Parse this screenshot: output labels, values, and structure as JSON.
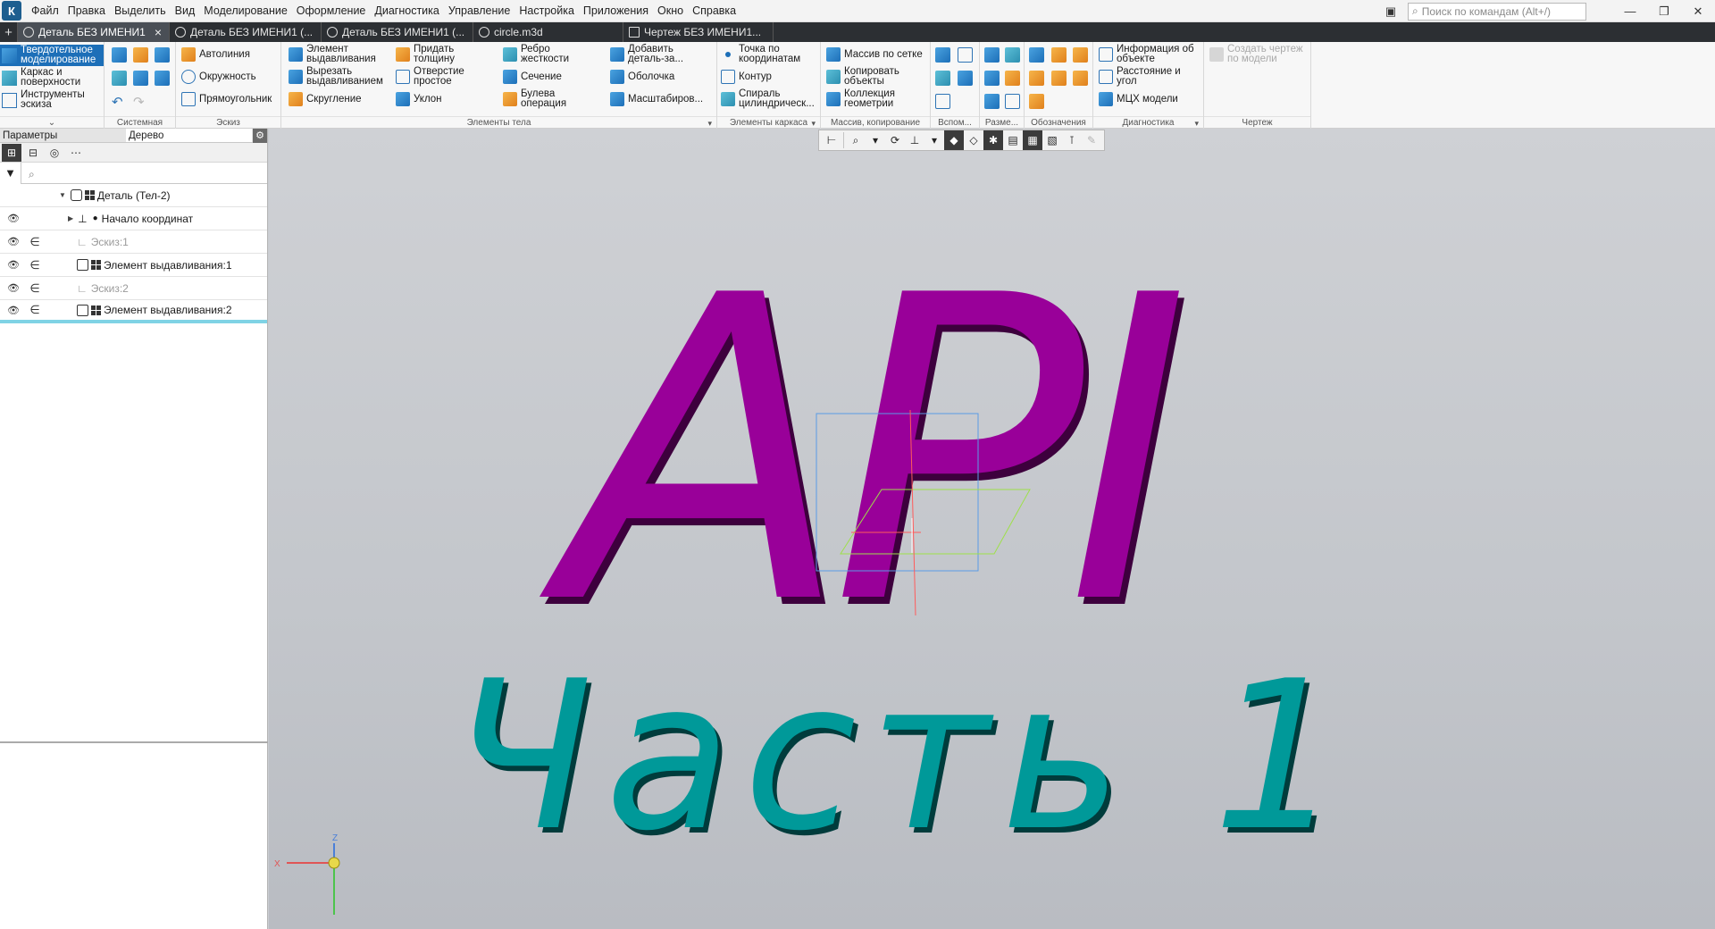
{
  "menu": [
    "Файл",
    "Правка",
    "Выделить",
    "Вид",
    "Моделирование",
    "Оформление",
    "Диагностика",
    "Управление",
    "Настройка",
    "Приложения",
    "Окно",
    "Справка"
  ],
  "search": {
    "placeholder": "Поиск по командам (Alt+/)"
  },
  "tabs": [
    {
      "label": "Деталь БЕЗ ИМЕНИ1",
      "active": true
    },
    {
      "label": "Деталь БЕЗ ИМЕНИ1 (...",
      "active": false
    },
    {
      "label": "Деталь БЕЗ ИМЕНИ1 (...",
      "active": false
    },
    {
      "label": "circle.m3d",
      "active": false
    },
    {
      "label": "Чертеж БЕЗ ИМЕНИ1...",
      "active": false
    }
  ],
  "ribbon": {
    "modes": [
      "Твердотельное моделирование",
      "Каркас и поверхности",
      "Инструменты эскиза"
    ],
    "groups": {
      "system": "Системная",
      "sketch": "Эскиз",
      "body": "Элементы тела",
      "frame": "Элементы каркаса",
      "array": "Массив, копирование",
      "aux": "Вспом...",
      "dims": "Разме...",
      "notation": "Обозначения",
      "diag": "Диагностика",
      "drawing": "Чертеж"
    },
    "sketch_buttons": [
      "Автолиния",
      "Окружность",
      "Прямоугольник"
    ],
    "body_buttons": [
      "Элемент выдавливания",
      "Вырезать выдавливанием",
      "Скругление",
      "Придать толщину",
      "Отверстие простое",
      "Уклон",
      "Ребро жесткости",
      "Сечение",
      "Булева операция",
      "Добавить деталь-за...",
      "Оболочка",
      "Масштабиров..."
    ],
    "frame_buttons": [
      "Точка по координатам",
      "Контур",
      "Спираль цилиндрическ..."
    ],
    "array_buttons": [
      "Массив по сетке",
      "Копировать объекты",
      "Коллекция геометрии"
    ],
    "diag_buttons": [
      "Информация об объекте",
      "Расстояние и угол",
      "МЦХ модели"
    ],
    "drawing_button": "Создать чертеж по модели"
  },
  "panel": {
    "tabs": [
      "Параметры",
      "Дерево"
    ],
    "search_placeholder": "",
    "tree": [
      {
        "label": "Деталь (Тел-2)"
      },
      {
        "label": "Начало координат"
      },
      {
        "label": "Эскиз:1"
      },
      {
        "label": "Элемент выдавливания:1"
      },
      {
        "label": "Эскиз:2"
      },
      {
        "label": "Элемент выдавливания:2"
      }
    ]
  },
  "scene": {
    "text_top": "API",
    "text_bottom": "Часть 1",
    "color_top": "#990099",
    "color_top_side": "#3d003d",
    "color_bottom": "#009999",
    "color_bottom_side": "#003c3c",
    "axis_x": "X",
    "axis_z": "Z"
  }
}
